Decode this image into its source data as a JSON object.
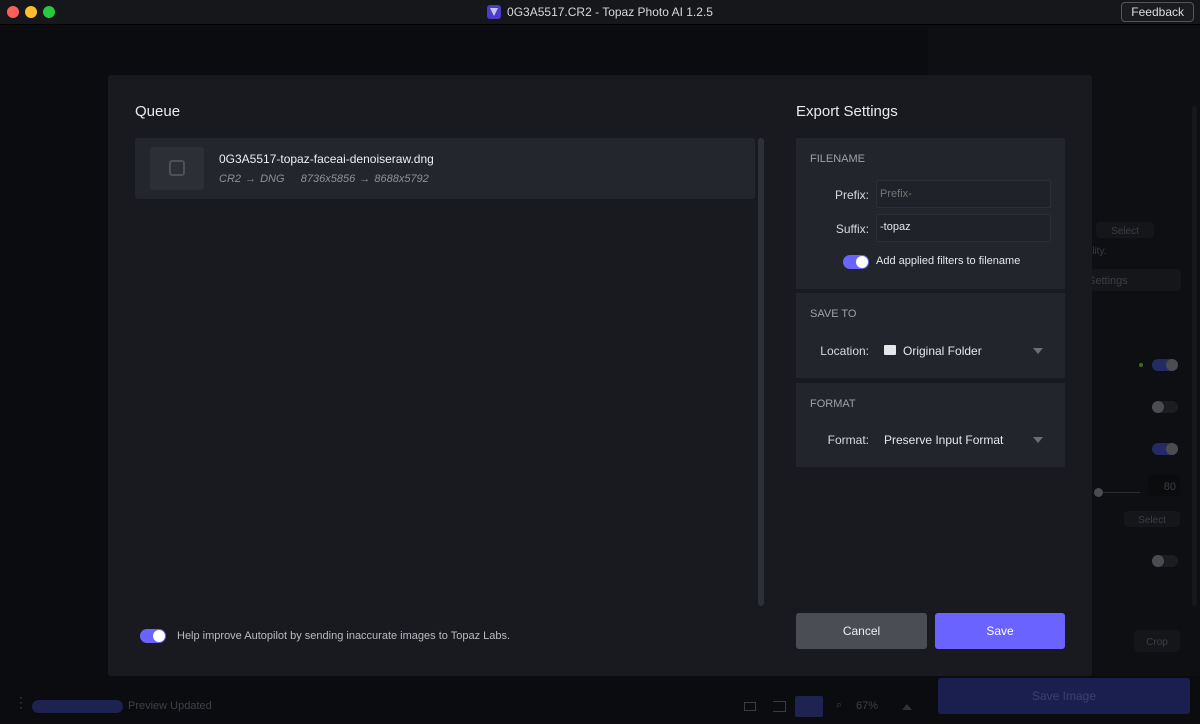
{
  "window": {
    "title": "0G3A5517.CR2 - Topaz Photo AI 1.2.5",
    "feedback": "Feedback"
  },
  "background": {
    "select_1": "Select",
    "partial_text": "ility.",
    "settings_btn": "Settings",
    "slider_value": "80",
    "select_2": "Select",
    "crop": "Crop",
    "save_image": "Save Image",
    "status_text": "Preview Updated",
    "zoom": "67%"
  },
  "queue": {
    "title": "Queue",
    "items": [
      {
        "filename": "0G3A5517-topaz-faceai-denoiseraw.dng",
        "conversion": "CR2 → DNG",
        "dimensions": "8736x5856 → 8688x5792"
      }
    ],
    "autopilot_toggle": {
      "on": true,
      "label": "Help improve Autopilot by sending inaccurate images to Topaz Labs."
    }
  },
  "export": {
    "title": "Export Settings",
    "filename": {
      "section": "FILENAME",
      "prefix_label": "Prefix:",
      "prefix_placeholder": "Prefix-",
      "prefix_value": "",
      "suffix_label": "Suffix:",
      "suffix_value": "-topaz",
      "filters_toggle": {
        "on": true,
        "label": "Add applied filters to filename"
      }
    },
    "save_to": {
      "section": "SAVE TO",
      "location_label": "Location:",
      "location_value": "Original Folder"
    },
    "format": {
      "section": "FORMAT",
      "format_label": "Format:",
      "format_value": "Preserve Input Format"
    },
    "cancel": "Cancel",
    "save": "Save"
  },
  "colors": {
    "accent": "#6a63ff",
    "modal_bg": "#181a20",
    "card_bg": "#22252c"
  }
}
